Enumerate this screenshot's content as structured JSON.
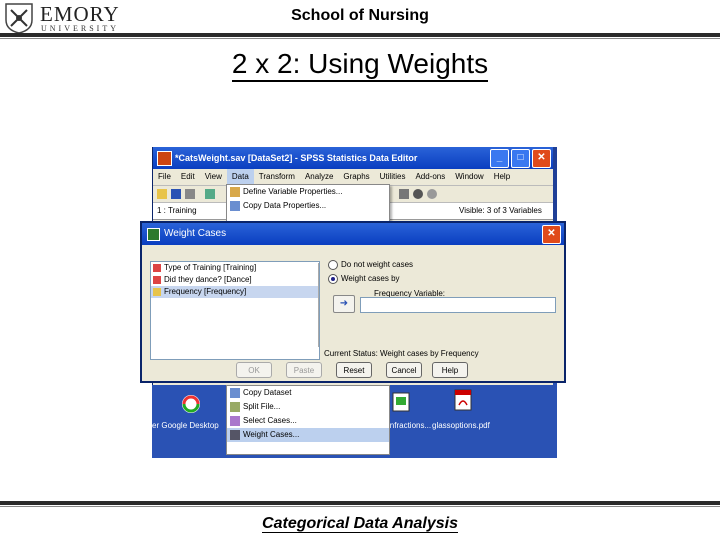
{
  "header": {
    "logo_word": "EMORY",
    "logo_sub": "UNIVERSITY",
    "school": "School of Nursing",
    "slide_title": "2 x 2: Using Weights"
  },
  "footer": {
    "text": "Categorical Data Analysis"
  },
  "spss": {
    "title": "*CatsWeight.sav [DataSet2] - SPSS Statistics Data Editor",
    "menus": [
      "File",
      "Edit",
      "View",
      "Data",
      "Transform",
      "Analyze",
      "Graphs",
      "Utilities",
      "Add-ons",
      "Window",
      "Help"
    ],
    "cell_ref": "1 : Training",
    "visible_text": "Visible: 3 of 3 Variables",
    "data_menu_top": [
      "Define Variable Properties...",
      "Copy Data Properties..."
    ],
    "data_menu_bottom": [
      "Copy Dataset",
      "Split File...",
      "Select Cases...",
      "Weight Cases..."
    ]
  },
  "dialog": {
    "title": "Weight Cases",
    "variables": [
      "Type of Training [Training]",
      "Did they dance? [Dance]",
      "Frequency [Frequency]"
    ],
    "radio_off": "Do not weight cases",
    "radio_on": "Weight cases by",
    "freq_label": "Frequency Variable:",
    "status": "Current Status: Weight cases by Frequency",
    "buttons": [
      "OK",
      "Paste",
      "Reset",
      "Cancel",
      "Help"
    ]
  },
  "desktop": {
    "icons": [
      "Google Desktop",
      "infractions...",
      "glassoptions.pdf"
    ]
  },
  "colors": {
    "titlebar": "#0a3ec0",
    "desktop": "#2a52b4",
    "close": "#e04a1a"
  }
}
